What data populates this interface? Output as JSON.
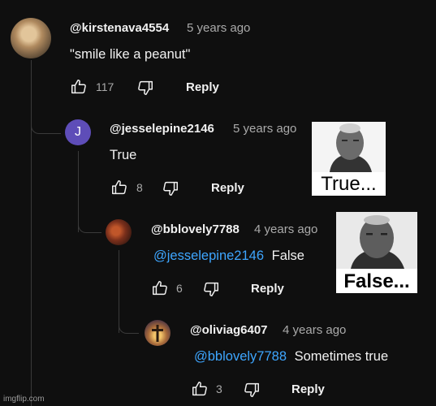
{
  "comments": [
    {
      "handle": "@kirstenava4554",
      "time": "5 years ago",
      "text": "\"smile like a peanut\"",
      "likes": "117",
      "reply_label": "Reply",
      "icons": [
        "thumbs-up-icon",
        "thumbs-down-icon"
      ]
    },
    {
      "handle": "@jesselepine2146",
      "avatar_initial": "J",
      "avatar_color": "#5e4db8",
      "time": "5 years ago",
      "text": "True",
      "likes": "8",
      "reply_label": "Reply"
    },
    {
      "handle": "@bblovely7788",
      "time": "4 years ago",
      "mention": "@jesselepine2146",
      "text": "False",
      "likes": "6",
      "reply_label": "Reply"
    },
    {
      "handle": "@oliviag6407",
      "time": "4 years ago",
      "mention": "@bblovely7788",
      "text": "Sometimes true",
      "likes": "3",
      "reply_label": "Reply"
    }
  ],
  "memes": [
    {
      "caption": "True..."
    },
    {
      "caption": "False..."
    }
  ],
  "watermark": "imgflip.com",
  "colors": {
    "background": "#0f0f0f",
    "mention": "#3ea6ff",
    "secondary_text": "#aaaaaa"
  }
}
